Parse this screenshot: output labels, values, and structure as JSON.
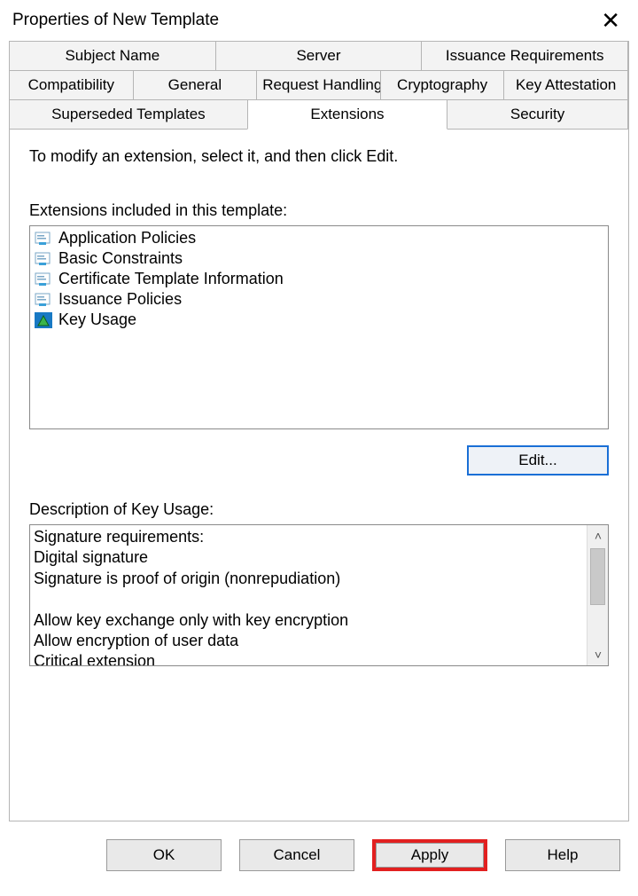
{
  "window": {
    "title": "Properties of New Template"
  },
  "tabs": {
    "row1": [
      "Subject Name",
      "Server",
      "Issuance Requirements"
    ],
    "row2": [
      "Compatibility",
      "General",
      "Request Handling",
      "Cryptography",
      "Key Attestation"
    ],
    "row3": [
      "Superseded Templates",
      "Extensions",
      "Security"
    ],
    "active": "Extensions"
  },
  "panel": {
    "instruction": "To modify an extension, select it, and then click Edit.",
    "list_label": "Extensions included in this template:",
    "items": [
      {
        "label": "Application Policies",
        "icon": "cert"
      },
      {
        "label": "Basic Constraints",
        "icon": "cert"
      },
      {
        "label": "Certificate Template Information",
        "icon": "cert"
      },
      {
        "label": "Issuance Policies",
        "icon": "cert"
      },
      {
        "label": "Key Usage",
        "icon": "key",
        "selected": true
      }
    ],
    "edit_label": "Edit...",
    "desc_label": "Description of Key Usage:",
    "description": "Signature requirements:\nDigital signature\nSignature is proof of origin (nonrepudiation)\n\nAllow key exchange only with key encryption\nAllow encryption of user data\nCritical extension"
  },
  "buttons": {
    "ok": "OK",
    "cancel": "Cancel",
    "apply": "Apply",
    "help": "Help"
  }
}
